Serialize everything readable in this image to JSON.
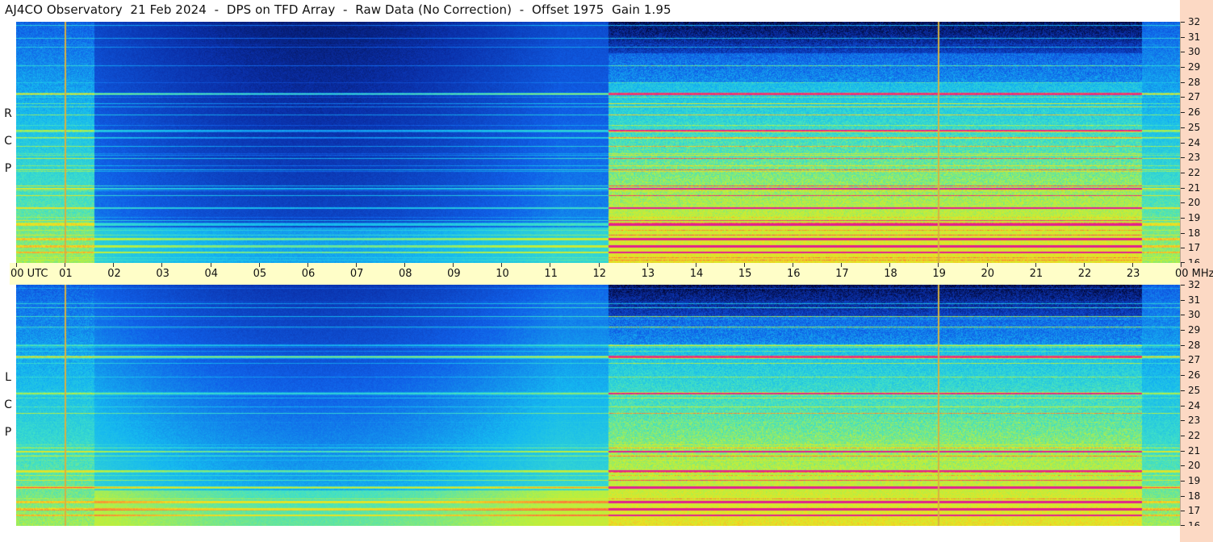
{
  "title": "AJ4CO Observatory  21 Feb 2024  -  DPS on TFD Array  -  Raw Data (No Correction)  -  Offset 1975  Gain 1.95",
  "panels": [
    {
      "polarization": "R C P",
      "letters": [
        "R",
        "C",
        "P"
      ]
    },
    {
      "polarization": "L C P",
      "letters": [
        "L",
        "C",
        "P"
      ]
    }
  ],
  "time_axis": {
    "labels": [
      "00  UTC",
      "01",
      "02",
      "03",
      "04",
      "05",
      "06",
      "07",
      "08",
      "09",
      "10",
      "11",
      "12",
      "13",
      "14",
      "15",
      "16",
      "17",
      "18",
      "19",
      "20",
      "21",
      "22",
      "23",
      "00 MHz"
    ]
  },
  "frequency_axis": {
    "unit": "MHz",
    "labels": [
      "32",
      "31",
      "30",
      "29",
      "28",
      "27",
      "26",
      "25",
      "24",
      "23",
      "22",
      "21",
      "20",
      "19",
      "18",
      "17",
      "16"
    ]
  },
  "chart_data": {
    "type": "heatmap",
    "title": "AJ4CO Observatory  21 Feb 2024  -  DPS on TFD Array  -  Raw Data (No Correction)  -  Offset 1975  Gain 1.95",
    "x": {
      "unit": "UTC hours",
      "range": [
        0,
        24
      ],
      "ticks": [
        0,
        1,
        2,
        3,
        4,
        5,
        6,
        7,
        8,
        9,
        10,
        11,
        12,
        13,
        14,
        15,
        16,
        17,
        18,
        19,
        20,
        21,
        22,
        23,
        24
      ]
    },
    "y": {
      "unit": "MHz",
      "range": [
        16,
        32
      ],
      "ticks": [
        16,
        17,
        18,
        19,
        20,
        21,
        22,
        23,
        24,
        25,
        26,
        27,
        28,
        29,
        30,
        31,
        32
      ]
    },
    "panels": [
      "R C P",
      "L C P"
    ],
    "marker_lines_utc": [
      1.0,
      19.0
    ],
    "colormap": [
      "#000020",
      "#0a2fa8",
      "#1060e8",
      "#15b8f0",
      "#3fe0c8",
      "#b8f040",
      "#f0e020",
      "#ff6040",
      "#e02090"
    ],
    "offset": 1975,
    "gain": 1.95
  }
}
